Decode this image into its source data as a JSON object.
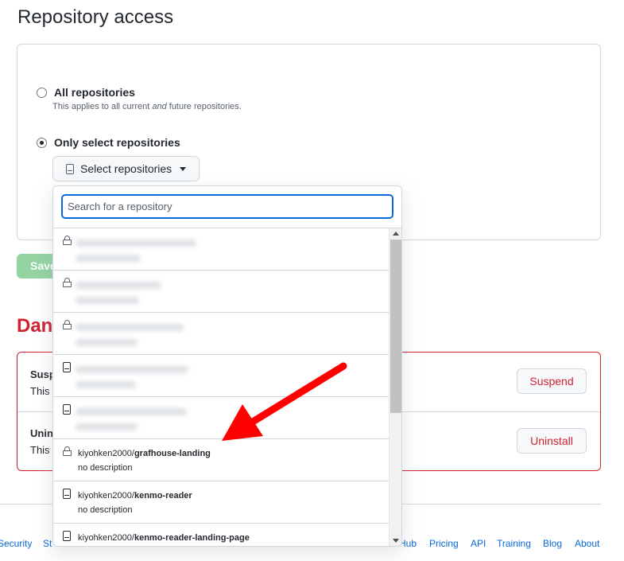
{
  "section": {
    "title": "Repository access",
    "options": [
      {
        "label": "All repositories",
        "note_prefix": "This applies to all current ",
        "note_em": "and",
        "note_suffix": " future repositories.",
        "checked": false
      },
      {
        "label": "Only select repositories",
        "checked": true
      }
    ],
    "select_button_label": "Select repositories",
    "save_button_label": "Save"
  },
  "danger_zone": {
    "title": "Danger zone",
    "rows": [
      {
        "title": "Suspend",
        "desc": "This",
        "button": "Suspend"
      },
      {
        "title": "Uninstall",
        "desc": "This",
        "button": "Uninstall"
      }
    ]
  },
  "dropdown": {
    "search_placeholder": "Search for a repository",
    "items": [
      {
        "icon": "lock-icon",
        "owner": "",
        "name": "",
        "desc": "",
        "redacted": true
      },
      {
        "icon": "lock-icon",
        "owner": "",
        "name": "",
        "desc": "",
        "redacted": true
      },
      {
        "icon": "lock-icon",
        "owner": "",
        "name": "",
        "desc": "",
        "redacted": true
      },
      {
        "icon": "repo-icon",
        "owner": "",
        "name": "",
        "desc": "",
        "redacted": true
      },
      {
        "icon": "repo-icon",
        "owner": "",
        "name": "",
        "desc": "",
        "redacted": true
      },
      {
        "icon": "lock-icon",
        "owner": "kiyohken2000/",
        "name": "grafhouse-landing",
        "desc": "no description",
        "redacted": false
      },
      {
        "icon": "repo-icon",
        "owner": "kiyohken2000/",
        "name": "kenmo-reader",
        "desc": "no description",
        "redacted": false
      },
      {
        "icon": "repo-icon",
        "owner": "kiyohken2000/",
        "name": "kenmo-reader-landing-page",
        "desc": "",
        "redacted": false
      }
    ]
  },
  "footer": {
    "links": [
      "Security",
      "Status",
      "GitHub",
      "Pricing",
      "API",
      "Training",
      "Blog",
      "About"
    ]
  },
  "annotation": {
    "color": "#ff0000"
  }
}
